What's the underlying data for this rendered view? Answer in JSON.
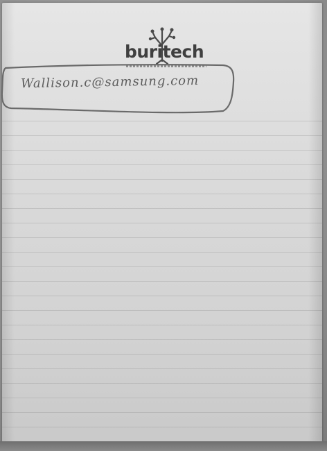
{
  "logo": {
    "text": "buritech"
  },
  "note": {
    "handwritten_text": "Wallison.c@samsung.com"
  },
  "colors": {
    "paper": "#dedede",
    "ink": "#5c5c5c",
    "logo_text": "#3f3f3f"
  }
}
